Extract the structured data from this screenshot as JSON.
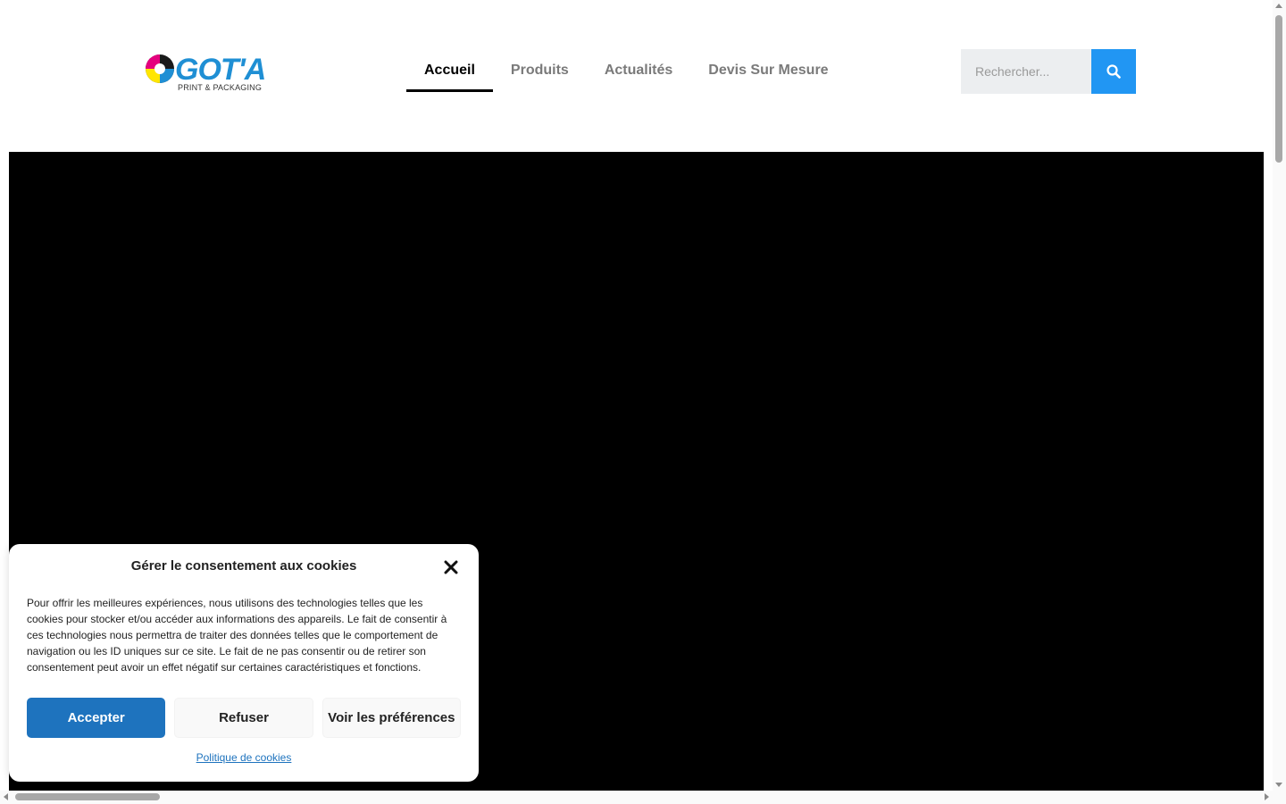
{
  "brand": {
    "name": "GOT'A",
    "tagline": "PRINT & PACKAGING",
    "colors": {
      "cyan": "#1f8fd4",
      "magenta": "#e5007e",
      "yellow": "#ffe600",
      "black": "#1a1a1a"
    }
  },
  "nav": {
    "items": [
      {
        "label": "Accueil",
        "active": true
      },
      {
        "label": "Produits",
        "active": false
      },
      {
        "label": "Actualités",
        "active": false
      },
      {
        "label": "Devis Sur Mesure",
        "active": false
      }
    ]
  },
  "search": {
    "placeholder": "Rechercher...",
    "value": "",
    "button_icon": "search-icon",
    "accent": "#2196f3"
  },
  "hero": {
    "background": "#000000"
  },
  "cookie_banner": {
    "title": "Gérer le consentement aux cookies",
    "body": "Pour offrir les meilleures expériences, nous utilisons des technologies telles que les cookies pour stocker et/ou accéder aux informations des appareils. Le fait de consentir à ces technologies nous permettra de traiter des données telles que le comportement de navigation ou les ID uniques sur ce site. Le fait de ne pas consentir ou de retirer son consentement peut avoir un effet négatif sur certaines caractéristiques et fonctions.",
    "accept_label": "Accepter",
    "deny_label": "Refuser",
    "prefs_label": "Voir les préférences",
    "policy_link": "Politique de cookies",
    "close_icon": "close-icon",
    "accent": "#1e73be"
  }
}
